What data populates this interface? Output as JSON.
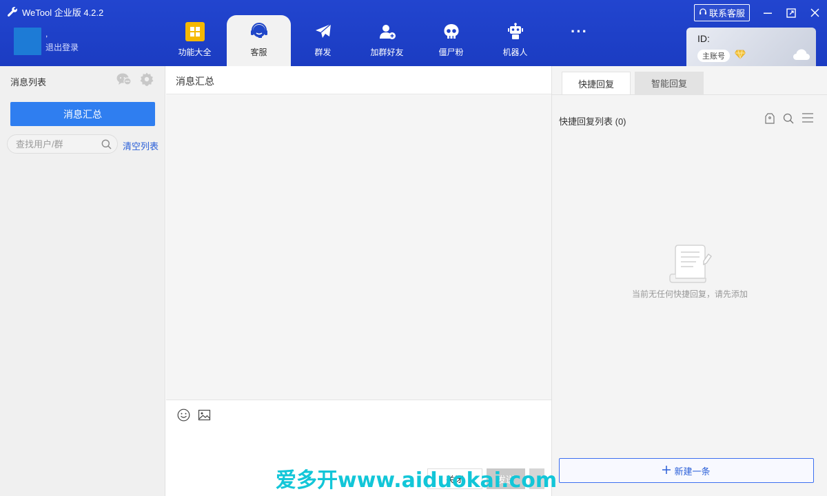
{
  "app": {
    "title": "WeTool 企业版 4.2.2",
    "contact_label": "联系客服"
  },
  "user": {
    "name": ",",
    "logout": "退出登录"
  },
  "nav": {
    "items": [
      {
        "label": "功能大全",
        "icon": "grid-icon",
        "active": false
      },
      {
        "label": "客服",
        "icon": "headset-icon",
        "active": true
      },
      {
        "label": "群发",
        "icon": "paper-plane-icon",
        "active": false
      },
      {
        "label": "加群好友",
        "icon": "add-user-icon",
        "active": false
      },
      {
        "label": "僵尸粉",
        "icon": "skull-icon",
        "active": false
      },
      {
        "label": "机器人",
        "icon": "robot-icon",
        "active": false
      },
      {
        "label": "",
        "icon": "more-icon",
        "active": false
      }
    ],
    "more": "···"
  },
  "account": {
    "id_label": "ID:",
    "badge": "主账号"
  },
  "left": {
    "title": "消息列表",
    "summary_button": "消息汇总",
    "search_placeholder": "查找用户/群",
    "clear_link": "清空列表"
  },
  "middle": {
    "title": "消息汇总",
    "close_button": "关闭",
    "send_button": "发送"
  },
  "right": {
    "tabs": [
      "快捷回复",
      "智能回复"
    ],
    "list_title": "快捷回复列表  (0)",
    "empty_text": "当前无任何快捷回复，请先添加",
    "new_button": "新建一条"
  },
  "watermark": "爱多开www.aiduokai.com",
  "colors": {
    "header": "#1e40c8",
    "primary_button": "#2f7ef0",
    "link": "#2a5fd8",
    "watermark": "#12c6d8"
  }
}
